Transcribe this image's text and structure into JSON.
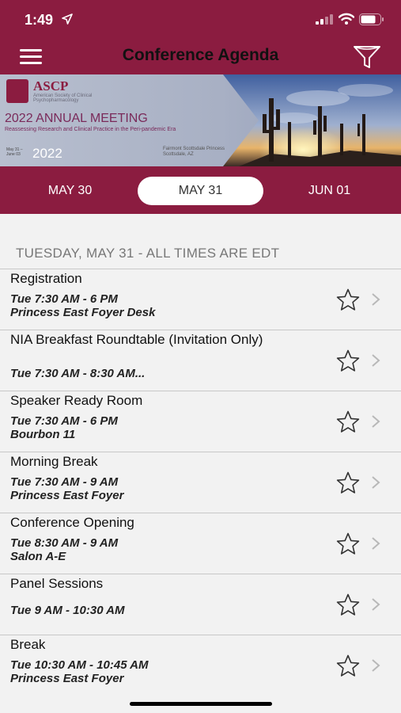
{
  "status_bar": {
    "time": "1:49"
  },
  "header": {
    "title": "Conference Agenda"
  },
  "banner": {
    "org": "ASCP",
    "org_full": "American Society of Clinical Psychopharmacology",
    "meeting": "2022 ANNUAL MEETING",
    "subtitle": "Reassessing Research and Clinical Practice in the Peri-pandemic Era",
    "dates": "May 31 – June 03",
    "year": "2022",
    "venue_line1": "Fairmont Scottsdale Princess",
    "venue_line2": "Scottsdale, AZ"
  },
  "date_tabs": [
    {
      "label": "MAY 30",
      "active": false
    },
    {
      "label": "MAY 31",
      "active": true
    },
    {
      "label": "JUN 01",
      "active": false
    }
  ],
  "section_header": "TUESDAY, MAY 31 - ALL TIMES ARE EDT",
  "sessions": [
    {
      "title": "Registration",
      "time": "Tue 7:30 AM - 6 PM",
      "location": "Princess East Foyer Desk"
    },
    {
      "title": "NIA Breakfast Roundtable (Invitation Only)",
      "time": "Tue 7:30 AM - 8:30 AM...",
      "location": ""
    },
    {
      "title": "Speaker Ready Room",
      "time": "Tue 7:30 AM - 6 PM",
      "location": "Bourbon 11"
    },
    {
      "title": "Morning Break",
      "time": "Tue 7:30 AM - 9 AM",
      "location": "Princess East Foyer"
    },
    {
      "title": "Conference Opening",
      "time": "Tue 8:30 AM - 9 AM",
      "location": "Salon A-E"
    },
    {
      "title": "Panel Sessions",
      "time": "Tue 9 AM - 10:30 AM",
      "location": ""
    },
    {
      "title": "Break",
      "time": "Tue 10:30 AM - 10:45 AM",
      "location": "Princess East Foyer"
    }
  ],
  "icons": {
    "menu": "hamburger-icon",
    "filter": "filter-funnel-icon",
    "favorite": "star-outline-icon",
    "disclosure": "chevron-right-icon"
  },
  "colors": {
    "brand": "#8b1c40"
  }
}
